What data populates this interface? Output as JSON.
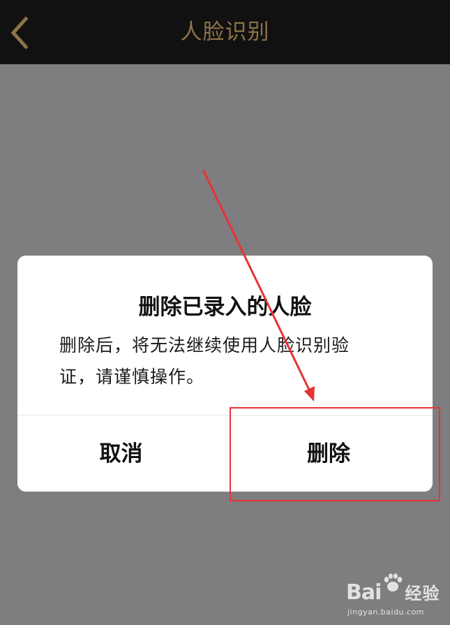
{
  "nav": {
    "title": "人脸识别",
    "back_icon": "chevron-left-icon"
  },
  "dialog": {
    "title": "删除已录入的人脸",
    "message_line1": "删除后，将无法继续使用人脸识别验",
    "message_line2": "证，请谨慎操作。",
    "cancel_label": "取消",
    "delete_label": "删除"
  },
  "annotation": {
    "color": "#e73335"
  },
  "watermark": {
    "brand_main": "Bai",
    "brand_paw_icon": "baidu-paw-icon",
    "brand_cn": "经验",
    "url": "jingyan.baidu.com"
  },
  "colors": {
    "nav_background": "#111111",
    "nav_text": "#8c7448",
    "overlay": "#7e7d80",
    "dialog_background": "#ffffff",
    "text_primary": "#111111"
  }
}
